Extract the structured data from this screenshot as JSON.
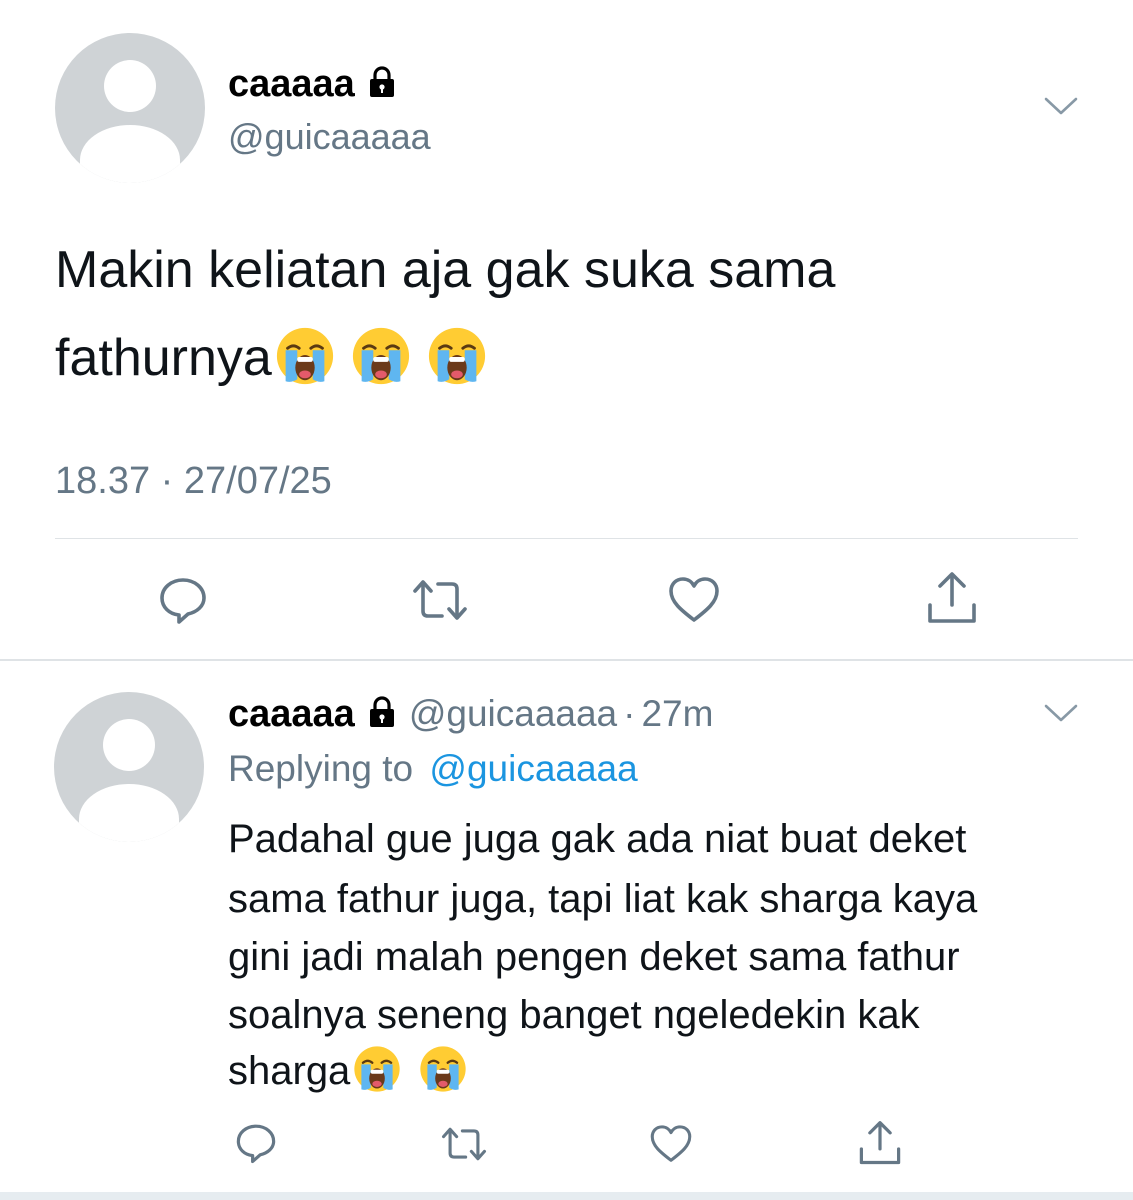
{
  "main_tweet": {
    "display_name": "caaaaa",
    "handle": "@guicaaaaa",
    "text_line1": "Makin keliatan aja gak suka sama",
    "text_line2": "fathurnya",
    "emojis": [
      "loudly-crying-face",
      "loudly-crying-face",
      "loudly-crying-face"
    ],
    "timestamp": "18.37 · 27/07/25"
  },
  "reply_tweet": {
    "display_name": "caaaaa",
    "handle": "@guicaaaaa",
    "time_sep": "·",
    "time": "27m",
    "replying_prefix": "Replying to",
    "replying_handle": "@guicaaaaa",
    "lines": [
      "Padahal gue juga gak ada niat buat deket",
      "sama fathur juga, tapi liat kak sharga kaya",
      "gini jadi malah pengen deket sama fathur",
      "soalnya seneng banget ngeledekin kak",
      "sharga"
    ],
    "emojis": [
      "loudly-crying-face",
      "loudly-crying-face"
    ]
  },
  "icons": {
    "reply": "reply-icon",
    "retweet": "retweet-icon",
    "like": "heart-icon",
    "share": "share-icon",
    "lock": "lock-icon",
    "chevron": "chevron-down-icon"
  },
  "colors": {
    "text": "#0f1419",
    "secondary": "#657786",
    "link": "#1b95e0",
    "divider": "#dfe3e6",
    "avatar_bg": "#cfd3d6"
  }
}
